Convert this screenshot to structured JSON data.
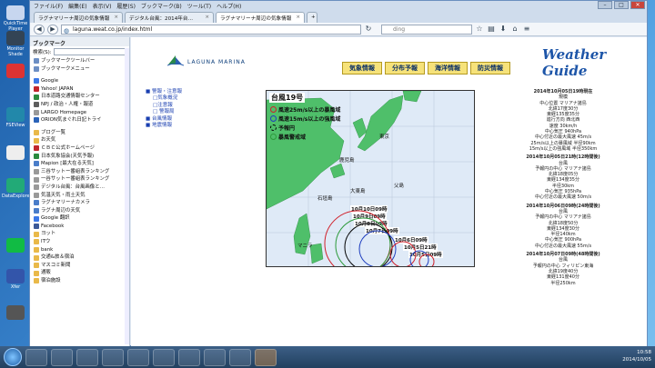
{
  "desktop": {
    "icons": [
      "QuickTime Player",
      "Monitor Shade",
      "",
      "FSEView",
      "",
      "DataExplorer",
      "",
      "",
      "Xfer",
      "",
      ""
    ]
  },
  "browser": {
    "menu": [
      "ファイル(F)",
      "編集(E)",
      "表示(V)",
      "履歴(S)",
      "ブックマーク(B)",
      "ツール(T)",
      "ヘルプ(H)"
    ],
    "tabs": [
      {
        "label": "ラグナマリーナ周辺の気象情報",
        "active": false
      },
      {
        "label": "デジタル台風：2014年台…",
        "active": false
      },
      {
        "label": "ラグナマリーナ周辺の気象情報",
        "active": true
      }
    ],
    "url": "laguna.weat.co.jp/index.html",
    "search_placeholder": "ding"
  },
  "sidebar": {
    "title": "ブックマーク",
    "search_label": "検索(S):",
    "items": [
      {
        "label": "ブックマークツールバー",
        "color": "#6d8fc4"
      },
      {
        "label": "ブックマークメニュー",
        "color": "#6d8fc4"
      },
      {
        "label": "",
        "color": ""
      },
      {
        "label": "Google",
        "color": "#3b78e7"
      },
      {
        "label": "Yahoo! JAPAN",
        "color": "#c0262d"
      },
      {
        "label": "日本道路交通情報センター",
        "color": "#2b8a3e"
      },
      {
        "label": "NPJ / 政治・人権・報道",
        "color": "#5d5d5d"
      },
      {
        "label": "LARGO Homepage",
        "color": "#999999"
      },
      {
        "label": "ORION気まぐれ日記トライ",
        "color": "#2b63b8"
      },
      {
        "label": "",
        "color": ""
      },
      {
        "label": "ブログ一覧",
        "color": "#e9b949"
      },
      {
        "label": "お天気",
        "color": "#e9b949"
      },
      {
        "label": "ＣＢＣ公式ホームページ",
        "color": "#c0262d"
      },
      {
        "label": "日本気象協会(天気予報)",
        "color": "#2b8a3e"
      },
      {
        "label": "Mapion [最大在る天気]",
        "color": "#4a7dc9"
      },
      {
        "label": "三谷サットー番組表ランキング",
        "color": "#999999"
      },
      {
        "label": "一谷サットー番組表ランキング",
        "color": "#999999"
      },
      {
        "label": "デジタル台風：台風画像と…",
        "color": "#999999"
      },
      {
        "label": "気温天気・雨土天気",
        "color": "#999999"
      },
      {
        "label": "ラグナマリーナカメラ",
        "color": "#4a7dc9"
      },
      {
        "label": "ラグナ周辺の天気",
        "color": "#4a7dc9"
      },
      {
        "label": "Google 翻訳",
        "color": "#3b78e7"
      },
      {
        "label": "Facebook",
        "color": "#3b5998"
      },
      {
        "label": "ヨット",
        "color": "#e9b949"
      },
      {
        "label": "ITウ",
        "color": "#e9b949"
      },
      {
        "label": "bank",
        "color": "#e9b949"
      },
      {
        "label": "交通&旅＆宿泊",
        "color": "#e9b949"
      },
      {
        "label": "マスコミ新聞",
        "color": "#e9b949"
      },
      {
        "label": "通販",
        "color": "#e9b949"
      },
      {
        "label": "宿泊施設",
        "color": "#e9b949"
      }
    ]
  },
  "site": {
    "logo_text": "LAGUNA MARINA",
    "brand": "Weather Guide",
    "nav": [
      "気象情報",
      "分布予報",
      "海洋情報",
      "防災情報"
    ],
    "left_links": [
      {
        "label": "■ 警報・注意報",
        "sub": false
      },
      {
        "label": "□気象概況",
        "sub": true
      },
      {
        "label": "□注意報",
        "sub": true
      },
      {
        "label": "□ 警報局",
        "sub": true
      },
      {
        "label": "■ 台風情報",
        "sub": false
      },
      {
        "label": "■ 地震情報",
        "sub": false
      }
    ]
  },
  "typhoon": {
    "title": "台風19号",
    "legend": [
      {
        "label": "風速25m/s以上の暴風域",
        "color": "#d0202a",
        "kind": "circle"
      },
      {
        "label": "風速15m/s以上の強風域",
        "color": "#1f3fbf",
        "kind": "circle"
      },
      {
        "label": "予報円",
        "color": "#000000",
        "kind": "dashed"
      },
      {
        "label": "暴風警戒域",
        "color": "#2c9a3a",
        "kind": "circle"
      }
    ],
    "places": [
      "東京",
      "鹿児島",
      "大東島",
      "石垣島",
      "父島",
      "マニラ"
    ],
    "forecast_labels": [
      "10月10日09時",
      "10月9日09時",
      "10月8日09時",
      "10月7日09時",
      "10月6日09時",
      "10月5日21時",
      "10月5日09時"
    ]
  },
  "info": {
    "blocks": [
      {
        "header": "2014年10月05日19時現在",
        "rows": [
          "規模",
          "中心位置 マリアナ諸島",
          "北緯17度30分",
          "東経135度35分",
          "進行方向 西北西",
          "速度 30km/h",
          "中心気圧 940hPa",
          "中心付近の最大風速 45m/s",
          "25m/s以上の暴風域 半径90km",
          "15m/s以上の強風域 半径350km"
        ]
      },
      {
        "header": "2014年10月05日21時(12時間後)",
        "rows": [
          "台風",
          "予報円の中心 マリアナ諸島",
          "北緯18度05分",
          "東経134度35分",
          "半径30km",
          "中心気圧 935hPa",
          "中心付近の最大風速 50m/s"
        ]
      },
      {
        "header": "2014年10月06日09時(24時間後)",
        "rows": [
          "台風",
          "予報円の中心 マリアナ諸島",
          "北緯18度50分",
          "東経134度30分",
          "半径140km",
          "中心気圧 900hPa",
          "中心付近の最大風速 55m/s"
        ]
      },
      {
        "header": "2014年10月07日09時(48時間後)",
        "rows": [
          "台風",
          "予報円の中心 フィリピン東海",
          "北緯19度40分",
          "東経131度40分",
          "半径250km"
        ]
      }
    ]
  },
  "taskbar": {
    "time": "10:58",
    "date": "2014/10/05"
  }
}
